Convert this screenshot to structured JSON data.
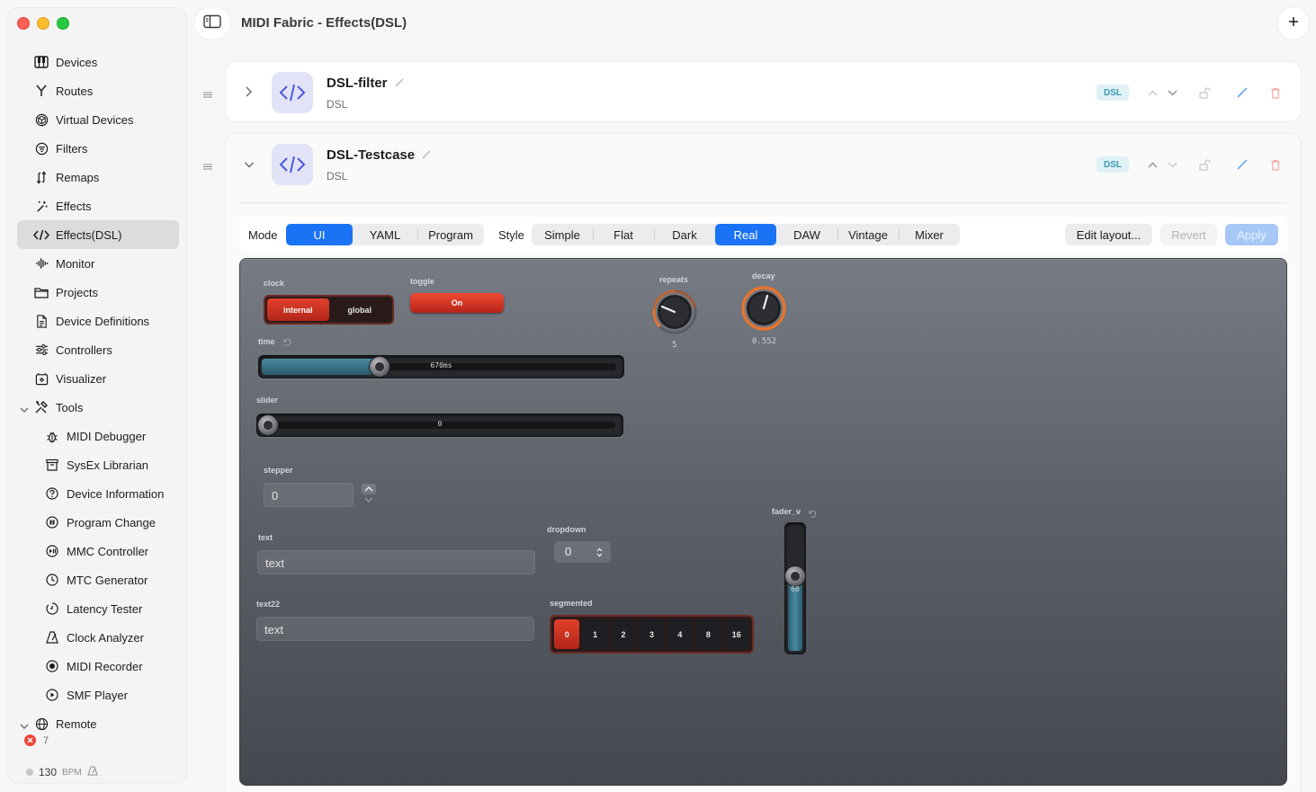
{
  "window": {
    "title": "MIDI Fabric - Effects(DSL)"
  },
  "sidebar": {
    "items": [
      {
        "label": "Devices",
        "icon": "piano-keys-icon"
      },
      {
        "label": "Routes",
        "icon": "fork-icon"
      },
      {
        "label": "Virtual Devices",
        "icon": "cube-icon"
      },
      {
        "label": "Filters",
        "icon": "filter-circle-icon"
      },
      {
        "label": "Remaps",
        "icon": "remap-arrows-icon"
      },
      {
        "label": "Effects",
        "icon": "wand-icon"
      },
      {
        "label": "Effects(DSL)",
        "icon": "code-icon",
        "selected": true
      },
      {
        "label": "Monitor",
        "icon": "waveform-icon"
      },
      {
        "label": "Projects",
        "icon": "folder-icon"
      },
      {
        "label": "Device Definitions",
        "icon": "document-icon"
      },
      {
        "label": "Controllers",
        "icon": "sliders-icon"
      },
      {
        "label": "Visualizer",
        "icon": "visualizer-icon"
      }
    ],
    "tools_group": {
      "label": "Tools",
      "icon": "tools-icon",
      "expanded": true
    },
    "tools": [
      {
        "label": "MIDI Debugger",
        "icon": "bug-icon"
      },
      {
        "label": "SysEx Librarian",
        "icon": "archive-icon"
      },
      {
        "label": "Device Information",
        "icon": "question-circle-icon"
      },
      {
        "label": "Program Change",
        "icon": "number-circle-icon"
      },
      {
        "label": "MMC Controller",
        "icon": "play-pause-circle-icon"
      },
      {
        "label": "MTC Generator",
        "icon": "clock-icon"
      },
      {
        "label": "Latency Tester",
        "icon": "timer-icon"
      },
      {
        "label": "Clock Analyzer",
        "icon": "metronome-icon"
      },
      {
        "label": "MIDI Recorder",
        "icon": "record-circle-icon"
      },
      {
        "label": "SMF Player",
        "icon": "play-circle-icon"
      }
    ],
    "remote_group": {
      "label": "Remote",
      "icon": "globe-icon"
    },
    "status": {
      "error_count": "7",
      "bpm": "130",
      "bpm_unit": "BPM"
    }
  },
  "cards": [
    {
      "title": "DSL-filter",
      "subtitle": "DSL",
      "tag": "DSL",
      "expanded": false
    },
    {
      "title": "DSL-Testcase",
      "subtitle": "DSL",
      "tag": "DSL",
      "expanded": true
    }
  ],
  "toolbar": {
    "mode_label": "Mode",
    "modes": [
      "UI",
      "YAML",
      "Program"
    ],
    "mode_selected": "UI",
    "style_label": "Style",
    "styles": [
      "Simple",
      "Flat",
      "Dark",
      "Real",
      "DAW",
      "Vintage",
      "Mixer"
    ],
    "style_selected": "Real",
    "edit_label": "Edit layout...",
    "revert_label": "Revert",
    "apply_label": "Apply"
  },
  "panel": {
    "clock": {
      "label": "clock",
      "options": [
        "internal",
        "global"
      ],
      "selected": "internal"
    },
    "toggle": {
      "label": "toggle",
      "value": "On"
    },
    "time": {
      "label": "time",
      "value": "670ms",
      "fraction": 0.33
    },
    "slider": {
      "label": "slider",
      "value": "0",
      "fraction": 0.0
    },
    "stepper": {
      "label": "stepper",
      "value": "0"
    },
    "text": {
      "label": "text",
      "value": "text"
    },
    "text22": {
      "label": "text22",
      "value": "text"
    },
    "dropdown": {
      "label": "dropdown",
      "value": "0"
    },
    "segmented": {
      "label": "segmented",
      "options": [
        "0",
        "1",
        "2",
        "3",
        "4",
        "8",
        "16"
      ],
      "selected": "0"
    },
    "repeats": {
      "label": "repeats",
      "value": "5"
    },
    "decay": {
      "label": "decay",
      "value": "0.552"
    },
    "fader_v": {
      "label": "fader_v",
      "value": "60",
      "fraction": 0.6
    }
  },
  "colors": {
    "accent": "#1a73f5",
    "real_red": "#d7351f",
    "dsl_tag": "#3a9cb8"
  }
}
